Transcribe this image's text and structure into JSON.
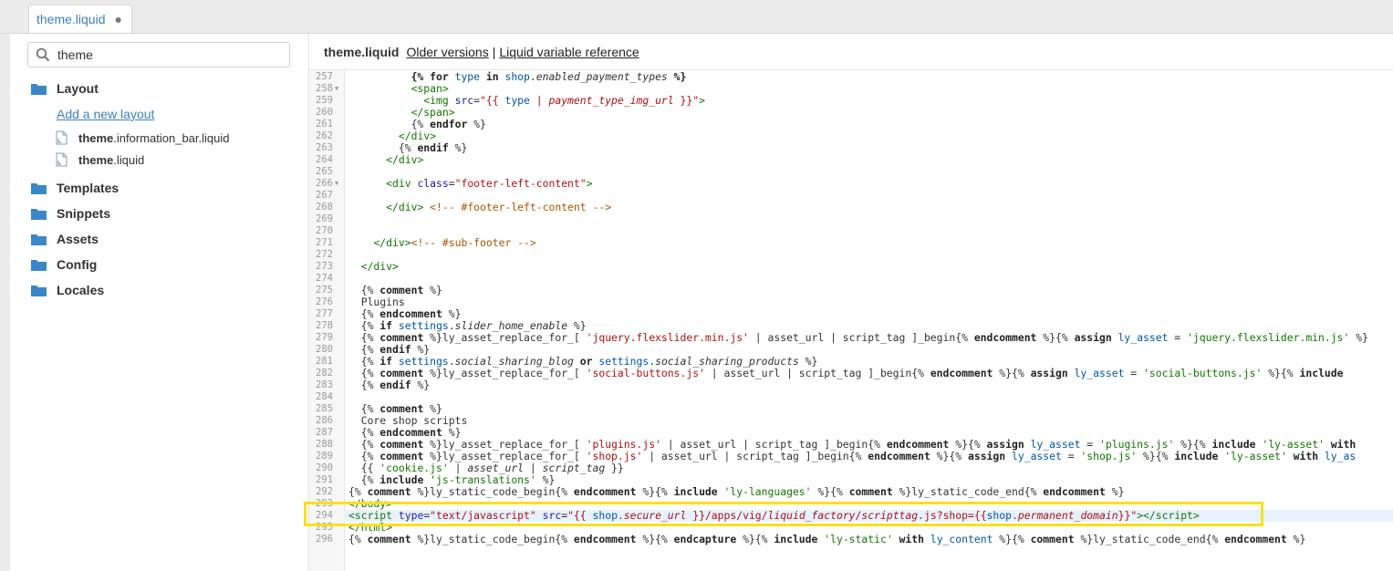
{
  "tab": {
    "label": "theme.liquid",
    "modified_dot": "●"
  },
  "sidebar": {
    "search_value": "theme",
    "folders": [
      {
        "label": "Layout"
      },
      {
        "label": "Templates"
      },
      {
        "label": "Snippets"
      },
      {
        "label": "Assets"
      },
      {
        "label": "Config"
      },
      {
        "label": "Locales"
      }
    ],
    "add_layout_label": "Add a new layout",
    "files": [
      {
        "bold": "theme",
        "rest": ".information_bar.liquid"
      },
      {
        "bold": "theme",
        "rest": ".liquid"
      }
    ]
  },
  "header": {
    "filename": "theme.liquid",
    "older_versions": "Older versions",
    "separator": "|",
    "liquid_ref": "Liquid variable reference"
  },
  "editor": {
    "lines": [
      {
        "n": "257",
        "fold": false,
        "html": "          <span class=\"k\">{%</span> <span class=\"kw\">for</span> <span class=\"v\">type</span> <span class=\"kw\">in</span> <span class=\"v\">shop</span>.<span class=\"i\">enabled_payment_types</span> <span class=\"k\">%}</span>"
      },
      {
        "n": "258",
        "fold": true,
        "html": "          <span class=\"t\">&lt;span&gt;</span>"
      },
      {
        "n": "259",
        "fold": false,
        "html": "            <span class=\"t\">&lt;img</span> <span class=\"a\">src</span>=<span class=\"s\">\"{{ <span class=\"v\">type</span> | <span class=\"i\">payment_type_img_url</span> }}\"</span><span class=\"t\">&gt;</span>"
      },
      {
        "n": "260",
        "fold": false,
        "html": "          <span class=\"t\">&lt;/span&gt;</span>"
      },
      {
        "n": "261",
        "fold": false,
        "html": "          {% <span class=\"kw\">endfor</span> %}"
      },
      {
        "n": "262",
        "fold": false,
        "html": "        <span class=\"t\">&lt;/div&gt;</span>"
      },
      {
        "n": "263",
        "fold": false,
        "html": "        {% <span class=\"kw\">endif</span> %}"
      },
      {
        "n": "264",
        "fold": false,
        "html": "      <span class=\"t\">&lt;/div&gt;</span>"
      },
      {
        "n": "265",
        "fold": false,
        "html": ""
      },
      {
        "n": "266",
        "fold": true,
        "html": "      <span class=\"t\">&lt;div</span> <span class=\"a\">class</span>=<span class=\"s\">\"footer-left-content\"</span><span class=\"t\">&gt;</span>"
      },
      {
        "n": "267",
        "fold": false,
        "html": ""
      },
      {
        "n": "268",
        "fold": false,
        "html": "      <span class=\"t\">&lt;/div&gt;</span> <span class=\"c\">&lt;!-- #footer-left-content --&gt;</span>"
      },
      {
        "n": "269",
        "fold": false,
        "html": ""
      },
      {
        "n": "270",
        "fold": false,
        "html": ""
      },
      {
        "n": "271",
        "fold": false,
        "html": "    <span class=\"t\">&lt;/div&gt;</span><span class=\"c\">&lt;!-- #sub-footer --&gt;</span>"
      },
      {
        "n": "272",
        "fold": false,
        "html": ""
      },
      {
        "n": "273",
        "fold": false,
        "html": "  <span class=\"t\">&lt;/div&gt;</span>"
      },
      {
        "n": "274",
        "fold": false,
        "html": ""
      },
      {
        "n": "275",
        "fold": false,
        "html": "  {% <span class=\"kw\">comment</span> %}"
      },
      {
        "n": "276",
        "fold": false,
        "html": "  Plugins"
      },
      {
        "n": "277",
        "fold": false,
        "html": "  {% <span class=\"kw\">endcomment</span> %}"
      },
      {
        "n": "278",
        "fold": false,
        "html": "  {% <span class=\"kw\">if</span> <span class=\"v\">settings</span>.<span class=\"i\">slider_home_enable</span> %}"
      },
      {
        "n": "279",
        "fold": false,
        "html": "  {% <span class=\"kw\">comment</span> %}ly_asset_replace_for_[ <span class=\"s\">'jquery.flexslider.min.js'</span> | asset_url | script_tag ]_begin{% <span class=\"kw\">endcomment</span> %}{% <span class=\"kw\">assign</span> <span class=\"v\">ly_asset</span> = <span class=\"g\">'jquery.flexslider.min.js'</span> %}"
      },
      {
        "n": "280",
        "fold": false,
        "html": "  {% <span class=\"kw\">endif</span> %}"
      },
      {
        "n": "281",
        "fold": false,
        "html": "  {% <span class=\"kw\">if</span> <span class=\"v\">settings</span>.<span class=\"i\">social_sharing_blog</span> <span class=\"kw\">or</span> <span class=\"v\">settings</span>.<span class=\"i\">social_sharing_products</span> %}"
      },
      {
        "n": "282",
        "fold": false,
        "html": "  {% <span class=\"kw\">comment</span> %}ly_asset_replace_for_[ <span class=\"s\">'social-buttons.js'</span> | asset_url | script_tag ]_begin{% <span class=\"kw\">endcomment</span> %}{% <span class=\"kw\">assign</span> <span class=\"v\">ly_asset</span> = <span class=\"g\">'social-buttons.js'</span> %}{% <span class=\"kw\">include</span>"
      },
      {
        "n": "283",
        "fold": false,
        "html": "  {% <span class=\"kw\">endif</span> %}"
      },
      {
        "n": "284",
        "fold": false,
        "html": ""
      },
      {
        "n": "285",
        "fold": false,
        "html": "  {% <span class=\"kw\">comment</span> %}"
      },
      {
        "n": "286",
        "fold": false,
        "html": "  Core shop scripts"
      },
      {
        "n": "287",
        "fold": false,
        "html": "  {% <span class=\"kw\">endcomment</span> %}"
      },
      {
        "n": "288",
        "fold": false,
        "html": "  {% <span class=\"kw\">comment</span> %}ly_asset_replace_for_[ <span class=\"s\">'plugins.js'</span> | asset_url | script_tag ]_begin{% <span class=\"kw\">endcomment</span> %}{% <span class=\"kw\">assign</span> <span class=\"v\">ly_asset</span> = <span class=\"g\">'plugins.js'</span> %}{% <span class=\"kw\">include</span> <span class=\"g\">'ly-asset'</span> <span class=\"kw\">with</span>"
      },
      {
        "n": "289",
        "fold": false,
        "html": "  {% <span class=\"kw\">comment</span> %}ly_asset_replace_for_[ <span class=\"s\">'shop.js'</span> | asset_url | script_tag ]_begin{% <span class=\"kw\">endcomment</span> %}{% <span class=\"kw\">assign</span> <span class=\"v\">ly_asset</span> = <span class=\"g\">'shop.js'</span> %}{% <span class=\"kw\">include</span> <span class=\"g\">'ly-asset'</span> <span class=\"kw\">with</span> <span class=\"v\">ly_as</span>"
      },
      {
        "n": "290",
        "fold": false,
        "html": "  {{ <span class=\"g\">'cookie.js'</span> | <span class=\"i\">asset_url</span> | <span class=\"i\">script_tag</span> }}"
      },
      {
        "n": "291",
        "fold": false,
        "html": "  {% <span class=\"kw\">include</span> <span class=\"g\">'js-translations'</span> %}"
      },
      {
        "n": "292",
        "fold": false,
        "html": "{% <span class=\"kw\">comment</span> %}ly_static_code_begin{% <span class=\"kw\">endcomment</span> %}{% <span class=\"kw\">include</span> <span class=\"g\">'ly-languages'</span> %}{% <span class=\"kw\">comment</span> %}ly_static_code_end{% <span class=\"kw\">endcomment</span> %}"
      },
      {
        "n": "293",
        "fold": false,
        "html": "<span class=\"t\">&lt;/body&gt;</span>"
      },
      {
        "n": "294",
        "fold": false,
        "highlight": true,
        "html": "<span class=\"t\">&lt;script</span> <span class=\"a\">type</span>=<span class=\"s\">\"text/javascript\"</span> <span class=\"a\">src</span>=<span class=\"s\">\"{{ <span class=\"v\">shop</span>.<span class=\"i\">secure_url</span> }}/apps/vig/<span class=\"i\">liquid_factory</span>/<span class=\"i\">scripttag</span>.js?shop={{<span class=\"v\">shop</span>.<span class=\"i\">permanent_domain</span>}}\"</span><span class=\"t\">&gt;&lt;/script&gt;</span>"
      },
      {
        "n": "295",
        "fold": false,
        "html": "<span class=\"t\">&lt;/html&gt;</span>"
      },
      {
        "n": "296",
        "fold": false,
        "html": "{% <span class=\"kw\">comment</span> %}ly_static_code_begin{% <span class=\"kw\">endcomment</span> %}{% <span class=\"kw\">endcapture</span> %}{% <span class=\"kw\">include</span> <span class=\"g\">'ly-static'</span> <span class=\"kw\">with</span> <span class=\"v\">ly_content</span> %}{% <span class=\"kw\">comment</span> %}ly_static_code_end{% <span class=\"kw\">endcomment</span> %}"
      }
    ]
  },
  "colors": {
    "link": "#3d7fbf",
    "folder": "#3a87c8",
    "highlight_box": "#f7e11b"
  }
}
